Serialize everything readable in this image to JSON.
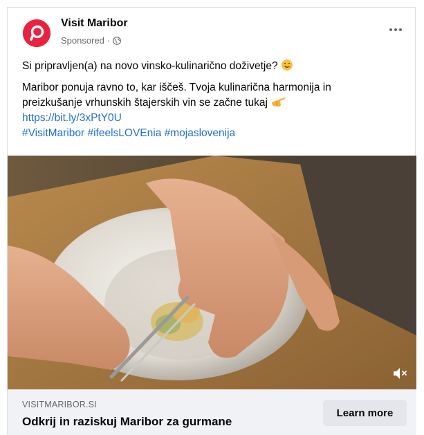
{
  "post": {
    "page_name": "Visit Maribor",
    "sponsored_label": "Sponsored",
    "separator": "·",
    "line1": "Si pripravljen(a) na novo vinsko-kulinarično doživetje?",
    "line2": "Maribor ponuja ravno to, kar iščeš. Tvoja kulinarična harmonija in",
    "line3": "preizkušanje vrhunskih štajerskih vin se začne tukaj",
    "url": "https://bit.ly/3xPtY0U",
    "hashtags": "#VisitMaribor #ifeelsLOVEnia #mojaslovenija"
  },
  "link_preview": {
    "domain": "VISITMARIBOR.SI",
    "headline": "Odkrij in raziskuj Maribor za gurmane",
    "cta_label": "Learn more"
  },
  "icons": {
    "avatar": "visit-maribor-logo",
    "privacy": "globe-icon",
    "menu": "more-horizontal-icon",
    "emoji1": "smiling-face-emoji",
    "emoji2": "pointing-hand-emoji",
    "mute": "muted-speaker-icon"
  },
  "colors": {
    "brand": "#e8233f",
    "link": "#216fdb",
    "secondary_text": "#65676b",
    "footer_bg": "#f0f2f5",
    "button_bg": "#e4e6eb"
  }
}
